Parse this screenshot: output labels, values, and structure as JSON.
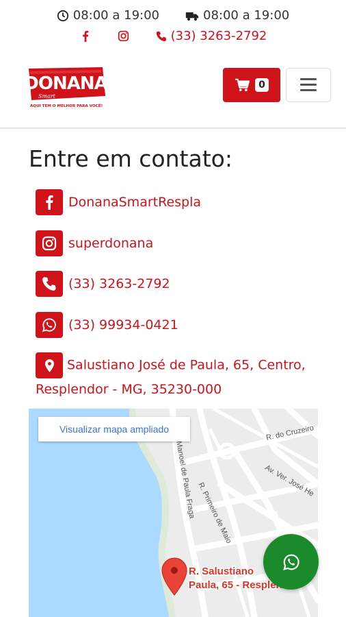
{
  "topbar": {
    "store_hours": "08:00 a 19:00",
    "delivery_hours": "08:00 a 19:00",
    "phone": "(33) 3263-2792"
  },
  "header": {
    "logo_text": "DONANA",
    "logo_sub": "Smart",
    "logo_tagline": "AQUI TEM O MELHOR PARA VOCÊ!",
    "cart_count": "0"
  },
  "contact": {
    "title": "Entre em contato:",
    "facebook": "DonanaSmartRespla",
    "instagram": "superdonana",
    "phone": "(33) 3263-2792",
    "whatsapp": "(33) 99934-0421",
    "address": "Salustiano José de Paula, 65, Centro, Resplendor - MG, 35230-000"
  },
  "map": {
    "link_label": "Visualizar mapa ampliado",
    "pin_label_line1": "R. Salustiano",
    "pin_label_line2": "Paula, 65 - Resplendor",
    "street_1": "Manoel de Paula Fraga",
    "street_2": "R. Primeiro de Maio",
    "street_3": "R. do Cruzeiro",
    "street_4": "Av. Ver. José He"
  },
  "colors": {
    "brand": "#d0121b",
    "whatsapp": "#1a8a2a",
    "water": "#aadaff"
  }
}
